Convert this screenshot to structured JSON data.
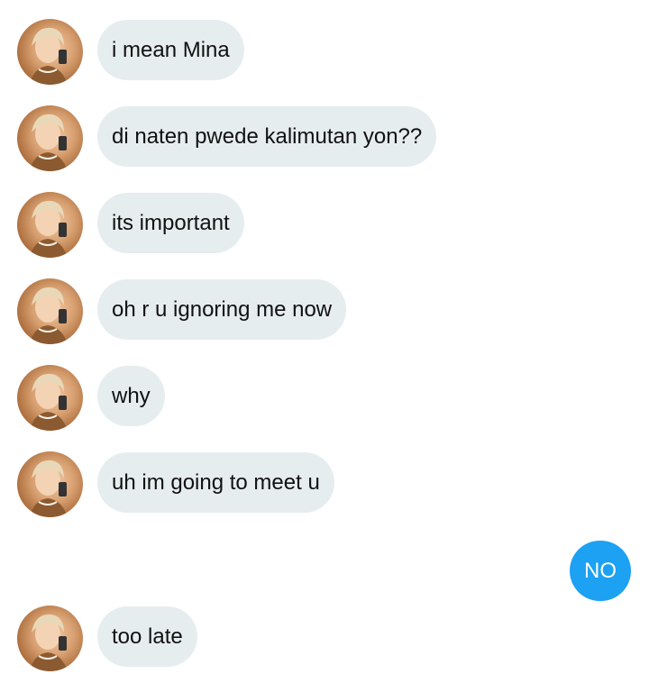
{
  "colors": {
    "incoming_bubble": "#e6edef",
    "outgoing_bubble": "#1da1f2",
    "incoming_text": "#111111",
    "outgoing_text": "#ffffff"
  },
  "messages": [
    {
      "direction": "incoming",
      "text": "i mean Mina"
    },
    {
      "direction": "incoming",
      "text": "di naten pwede kalimutan yon??"
    },
    {
      "direction": "incoming",
      "text": "its important"
    },
    {
      "direction": "incoming",
      "text": "oh r u ignoring me now"
    },
    {
      "direction": "incoming",
      "text": "why"
    },
    {
      "direction": "incoming",
      "text": "uh im going to meet u"
    },
    {
      "direction": "outgoing",
      "text": "NO"
    },
    {
      "direction": "incoming",
      "text": "too late"
    }
  ]
}
